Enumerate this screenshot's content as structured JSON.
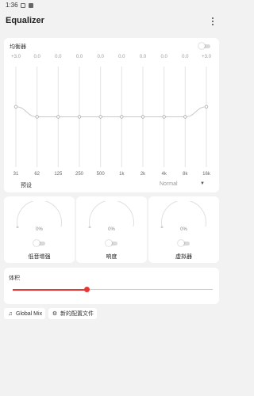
{
  "status_bar": {
    "time": "1:36"
  },
  "app_bar": {
    "title": "Equalizer",
    "more_icon": "more-vert-icon"
  },
  "equalizer": {
    "title": "均衡器",
    "enabled": false,
    "bands": [
      {
        "freq": "31",
        "db_label": "+3.0",
        "gain_db": 3.0
      },
      {
        "freq": "62",
        "db_label": "0.0",
        "gain_db": 0.0
      },
      {
        "freq": "125",
        "db_label": "0.0",
        "gain_db": 0.0
      },
      {
        "freq": "250",
        "db_label": "0.0",
        "gain_db": 0.0
      },
      {
        "freq": "500",
        "db_label": "0.0",
        "gain_db": 0.0
      },
      {
        "freq": "1k",
        "db_label": "0.0",
        "gain_db": 0.0
      },
      {
        "freq": "2k",
        "db_label": "0.0",
        "gain_db": 0.0
      },
      {
        "freq": "4k",
        "db_label": "0.0",
        "gain_db": 0.0
      },
      {
        "freq": "8k",
        "db_label": "0.0",
        "gain_db": 0.0
      },
      {
        "freq": "16k",
        "db_label": "+3.0",
        "gain_db": 3.0
      }
    ],
    "gain_range_db": [
      -15,
      15
    ],
    "preset_label": "预设",
    "preset_value": "Normal"
  },
  "effects": [
    {
      "value_text": "0%",
      "value": 0,
      "enabled": false,
      "label": "低音增强"
    },
    {
      "value_text": "0%",
      "value": 0,
      "enabled": false,
      "label": "响度"
    },
    {
      "value_text": "0%",
      "value": 0,
      "enabled": false,
      "label": "虚拟器"
    }
  ],
  "volume": {
    "title": "体积",
    "fraction": 0.37
  },
  "chips": {
    "global_mix": {
      "label": "Global Mix",
      "icon": "music-note-icon"
    },
    "new_profile": {
      "label": "新的配置文件",
      "icon": "settings-icon"
    }
  },
  "colors": {
    "accent": "#e53935",
    "background": "#f2f2f2",
    "card": "#ffffff"
  }
}
